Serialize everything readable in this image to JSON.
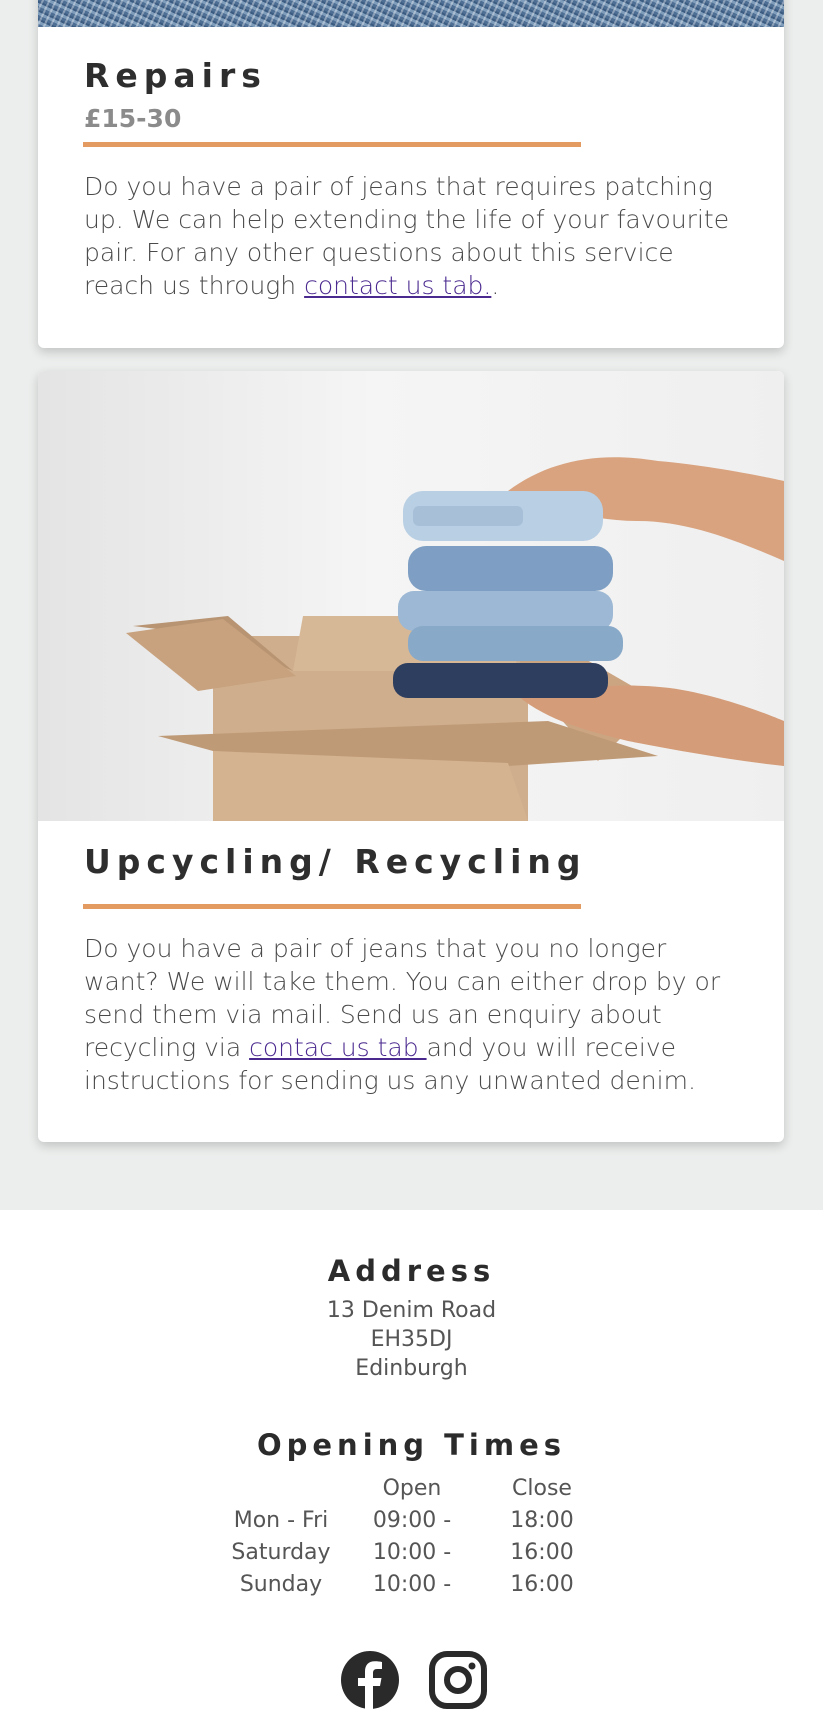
{
  "repairs": {
    "title": "Repairs",
    "price": "£15-30",
    "text_before_link": "Do you have a pair of jeans that requires patching up. We can help extending the life of your favourite pair. For any other questions about this service reach us through ",
    "link_text": "contact us tab.",
    "text_after_link": "."
  },
  "recycling": {
    "title": "Upcycling/ Recycling",
    "text_before_link": "Do you have a pair of jeans that you no longer want? We will take them. You can either drop by or send them via mail. Send us an enquiry about recycling via ",
    "link_text": "contac us tab ",
    "text_after_link": "and you will receive instructions for sending us any unwanted denim."
  },
  "footer": {
    "address_heading": "Address",
    "address_lines": [
      "13 Denim Road",
      "EH35DJ",
      "Edinburgh"
    ],
    "hours_heading": "Opening Times",
    "hours_header": {
      "day": "",
      "open": "Open",
      "close": "Close"
    },
    "hours": [
      {
        "day": "Mon - Fri",
        "open": "09:00 -",
        "close": "18:00"
      },
      {
        "day": "Saturday",
        "open": "10:00 -",
        "close": "16:00"
      },
      {
        "day": "Sunday",
        "open": "10:00 -",
        "close": "16:00"
      }
    ],
    "social": [
      "facebook-icon",
      "instagram-icon"
    ]
  },
  "colors": {
    "accent_rule": "#e39b62",
    "link": "#4b2a8f",
    "page_bg": "#eceeed"
  }
}
